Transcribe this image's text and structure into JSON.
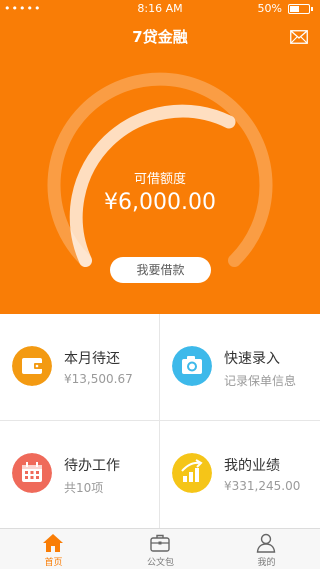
{
  "status_bar": {
    "carrier": "•••••",
    "time": "8:16 AM",
    "battery": "50%"
  },
  "header": {
    "title": "7贷金融"
  },
  "credit": {
    "label": "可借额度",
    "amount": "¥6,000.00",
    "borrow_button": "我要借款"
  },
  "grid": [
    {
      "title": "本月待还",
      "subtitle": "¥13,500.67",
      "icon": "wallet-icon",
      "color": "#f39a12"
    },
    {
      "title": "快速录入",
      "subtitle": "记录保单信息",
      "icon": "camera-icon",
      "color": "#3db9ea"
    },
    {
      "title": "待办工作",
      "subtitle": "共10项",
      "icon": "calendar-icon",
      "color": "#ef6a5a"
    },
    {
      "title": "我的业绩",
      "subtitle": "¥331,245.00",
      "icon": "growth-chart-icon",
      "color": "#f5c518"
    }
  ],
  "tabs": [
    {
      "label": "首页",
      "icon": "home-icon",
      "active": true
    },
    {
      "label": "公文包",
      "icon": "briefcase-icon",
      "active": false
    },
    {
      "label": "我的",
      "icon": "user-icon",
      "active": false
    }
  ],
  "colors": {
    "brand_orange": "#f97d06"
  }
}
